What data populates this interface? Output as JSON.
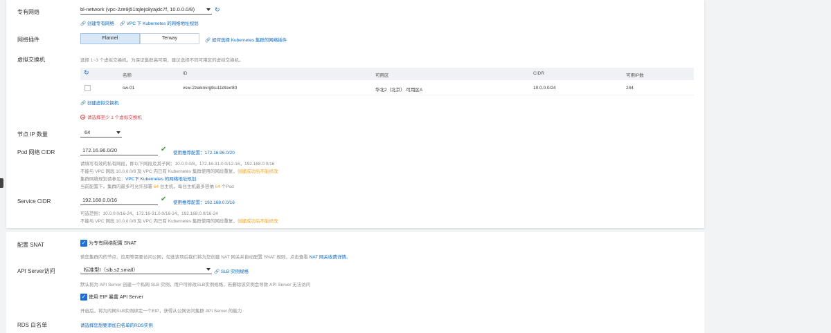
{
  "vpc": {
    "label": "专有网络",
    "selected": "bl-network (vpc-2ze9j51tqlejs8yajdc7f, 10.0.0.0/8)",
    "create_link": "创建专有网络",
    "plan_link": "VPC 下 Kubernetes 的网络地址规划"
  },
  "plugin": {
    "label": "网络插件",
    "options": [
      "Flannel",
      "Terway"
    ],
    "help_link": "如何选择 Kubernetes 集群的网络插件"
  },
  "vswitch": {
    "label": "虚拟交换机",
    "help": "选择 1~3 个虚拟交换机。为保证集群高可用，建议选择不同可用区的虚拟交换机。",
    "columns": [
      "名称",
      "ID",
      "可用区",
      "CIDR",
      "可用IP数"
    ],
    "rows": [
      {
        "name": "sw-01",
        "id": "vsw-2zeiknvrgtku11dtoxr80",
        "zone": "华北2（北京） 可用区A",
        "cidr": "10.0.0.0/24",
        "ips": "244"
      }
    ],
    "create_link": "创建虚拟交换机",
    "error": "请选择至少 1 个虚拟交换机"
  },
  "node_ip": {
    "label": "节点 IP 数量",
    "value": "64"
  },
  "pod_cidr": {
    "label": "Pod 网络 CIDR",
    "value": "172.16.96.0/20",
    "recommend_prefix": "使用推荐配置：",
    "recommend_value": "172.16.96.0/20",
    "help1": "请填写有效的私有网段，即以下网段及其子网：10.0.0.0/8，172.16-31.0.0/12-16，192.168.0.0/16",
    "help2": "不能与 VPC 网段 10.0.0.0/8 及 VPC 内已有 Kubernetes 集群使用的网段重复，",
    "help2_warn": "创建成功后不能修改",
    "help3": "集群网络规划请参见：",
    "help3_link": "VPC下 Kubernetes 的网络地址规划",
    "help4_a": "当前配置下，集群内最多可允许部署 ",
    "help4_num1": "64",
    "help4_b": " 台主机，每台主机最多容纳 ",
    "help4_num2": "64",
    "help4_c": " 个Pod"
  },
  "service_cidr": {
    "label": "Service CIDR",
    "value": "192.168.0.0/16",
    "recommend_prefix": "使用推荐配置：",
    "recommend_value": "192.168.0.0/16",
    "help1": "可选范围：10.0.0.0/16-24，172.16-31.0.0/16-24，192.168.0.0/16-24",
    "help2": "不能与 VPC 网段 10.0.0.0/8 及 VPC 内已有 Kubernetes 集群使用的网段重复，",
    "help2_warn": "创建成功后不能修改"
  },
  "snat": {
    "label": "配置 SNAT",
    "checkbox_label": "为专有网络配置 SNAT",
    "help": "若您集群内的节点、应用等需要访问公网，勾选该项后我们将为您创建 NAT 网关并自动配置 SNAT 规则，点击查看 ",
    "help_link": "NAT 网关收费详情",
    "help_end": "。"
  },
  "api_server": {
    "label": "API Server访问",
    "selected": "标准型I（slb.s2.small）",
    "spec_link": "SLB 实例规格",
    "help": "默认将为 API Server 创建一个私网 SLB 实例，用户可修改SLB实例规格，若删除该实例会导致 API Server 无法访问",
    "eip_label": "使用 EIP 暴露 API Server",
    "eip_help": "开启后，将为内网SLB实例绑定一个EIP，获得从公网访问集群 API Server 的能力"
  },
  "rds": {
    "label": "RDS 白名单",
    "link": "请选择您想要添加白名单的RDS实例"
  },
  "colors": {
    "link": "#0b6ac9",
    "error": "#e0424b",
    "warn": "#f5a623",
    "success": "#3aa33a",
    "checkbox": "#1e6fd6"
  }
}
